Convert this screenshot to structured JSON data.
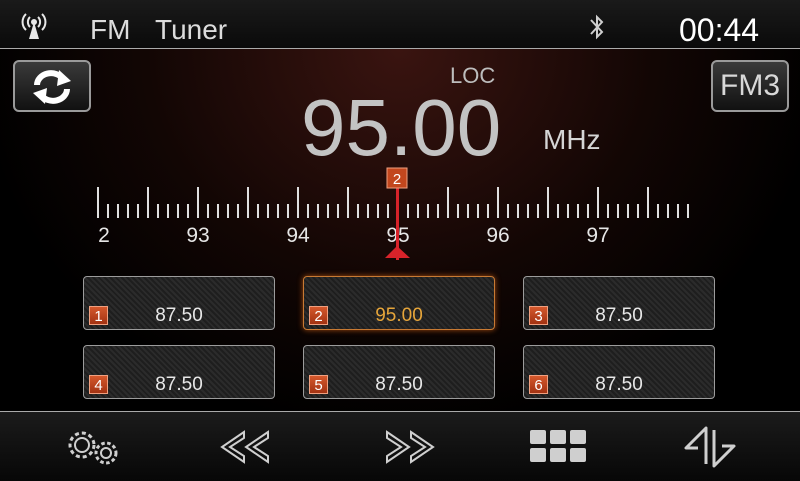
{
  "status": {
    "title_band": "FM",
    "title_mode": "Tuner",
    "time": "00:44"
  },
  "tuner": {
    "loc_label": "LOC",
    "frequency": "95.00",
    "unit": "MHz",
    "band_button": "FM3",
    "marker_number": "2",
    "scale_labels": [
      "2",
      "93",
      "94",
      "95",
      "96",
      "97"
    ]
  },
  "presets": [
    {
      "number": "1",
      "frequency": "87.50",
      "active": false
    },
    {
      "number": "2",
      "frequency": "95.00",
      "active": true
    },
    {
      "number": "3",
      "frequency": "87.50",
      "active": false
    },
    {
      "number": "4",
      "frequency": "87.50",
      "active": false
    },
    {
      "number": "5",
      "frequency": "87.50",
      "active": false
    },
    {
      "number": "6",
      "frequency": "87.50",
      "active": false
    }
  ],
  "toolbar": {
    "icons": [
      "settings-icon",
      "seek-back-icon",
      "seek-forward-icon",
      "preset-grid-icon",
      "band-switch-icon"
    ]
  },
  "colors": {
    "accent_red": "#d8232a",
    "preset_active": "#e6a53a",
    "preset_badge": "#c2471e"
  }
}
